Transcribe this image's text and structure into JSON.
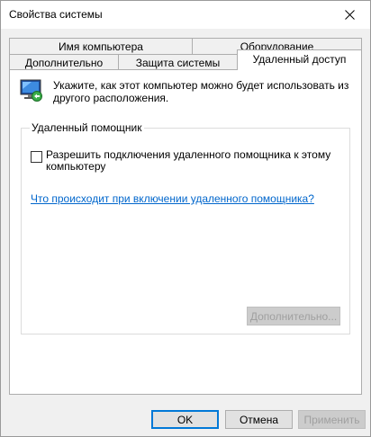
{
  "window": {
    "title": "Свойства системы"
  },
  "tabs": {
    "row_back": [
      "Имя компьютера",
      "Оборудование"
    ],
    "row_front": [
      "Дополнительно",
      "Защита системы",
      "Удаленный доступ"
    ],
    "active": "Удаленный доступ"
  },
  "remote_tab": {
    "intro_text": "Укажите, как этот компьютер можно будет использовать из другого расположения.",
    "assistance_group": {
      "label": "Удаленный помощник",
      "allow_checkbox_label": "Разрешить подключения удаленного помощника к этому компьютеру",
      "allow_checked": false,
      "help_link": "Что происходит при включении удаленного помощника?",
      "advanced_button": "Дополнительно..."
    }
  },
  "buttons": {
    "ok": "OK",
    "cancel": "Отмена",
    "apply": "Применить"
  },
  "colors": {
    "link": "#0066cc",
    "focus_border": "#0078d7"
  }
}
